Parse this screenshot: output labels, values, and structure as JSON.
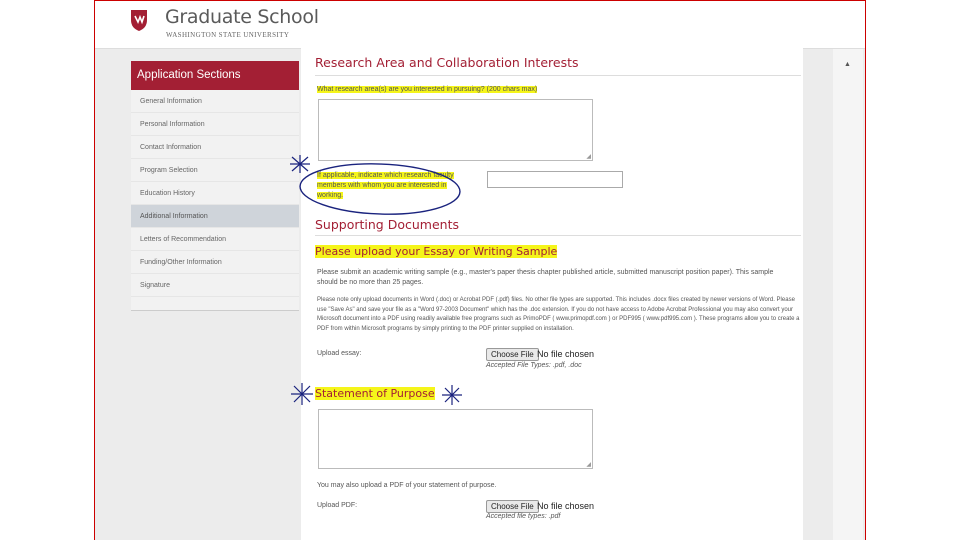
{
  "header": {
    "title": "Graduate School",
    "subtitle": "WASHINGTON STATE UNIVERSITY"
  },
  "sidebar": {
    "heading": "Application Sections",
    "items": [
      {
        "label": "General Information"
      },
      {
        "label": "Personal Information"
      },
      {
        "label": "Contact Information"
      },
      {
        "label": "Program Selection"
      },
      {
        "label": "Education History"
      },
      {
        "label": "Additional Information"
      },
      {
        "label": "Letters of Recommendation"
      },
      {
        "label": "Funding/Other Information"
      },
      {
        "label": "Signature"
      }
    ],
    "active_index": 5
  },
  "research": {
    "title": "Research Area and Collaboration Interests",
    "question": "What research area(s) are you interested in pursuing? (200 chars max)",
    "faculty_prompt": "If applicable, indicate which research faculty members with whom you are interested in working."
  },
  "supporting": {
    "title": "Supporting Documents",
    "essay_title": "Please upload your Essay or Writing Sample",
    "essay_desc": "Please submit an academic writing sample (e.g., master's paper thesis chapter published article, submitted manuscript position paper). This sample should be no more than 25 pages.",
    "format_note": "Please note only upload documents in Word (.doc) or Acrobat PDF (.pdf) files. No other file types are supported. This includes .docx files created by newer versions of Word. Please use \"Save As\" and save your file as a \"Word 97-2003 Document\" which has the .doc extension. If you do not have access to Adobe Acrobat Professional you may also convert your Microsoft document into a PDF using readily available free programs such as PrimoPDF ( www.primopdf.com ) or PDF995 ( www.pdf995.com ). These programs allow you to create a PDF from within Microsoft programs by simply printing to the PDF printer supplied on installation.",
    "upload_essay_label": "Upload essay:",
    "choose_file_label": "Choose File",
    "no_file_label": "No file chosen",
    "accepted_types": "Accepted File Types: .pdf, .doc",
    "statement_title": "Statement of Purpose",
    "statement_pdf_note": "You may also upload a PDF of your statement of purpose.",
    "upload_pdf_label": "Upload PDF:",
    "accepted_types_pdf": "Accepted file types: .pdf"
  },
  "colors": {
    "brand": "#a31f34",
    "highlight": "#f5f51a",
    "ink": "#1a237e"
  }
}
